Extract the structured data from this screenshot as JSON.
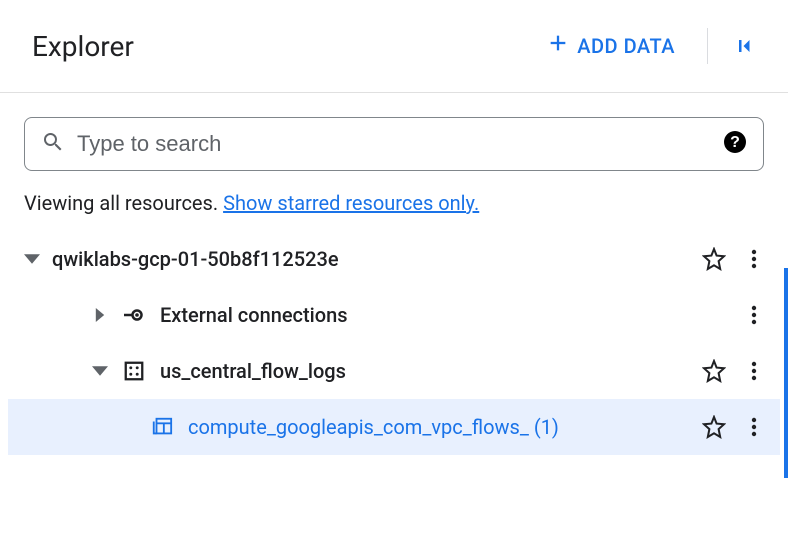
{
  "header": {
    "title": "Explorer",
    "add_data_label": "ADD DATA"
  },
  "search": {
    "placeholder": "Type to search"
  },
  "filter": {
    "prefix": "Viewing all resources. ",
    "link": "Show starred resources only."
  },
  "tree": {
    "project": {
      "label": "qwiklabs-gcp-01-50b8f112523e"
    },
    "external": {
      "label": "External connections"
    },
    "dataset": {
      "label": "us_central_flow_logs"
    },
    "table": {
      "label": "compute_googleapis_com_vpc_flows_ (1)"
    }
  }
}
